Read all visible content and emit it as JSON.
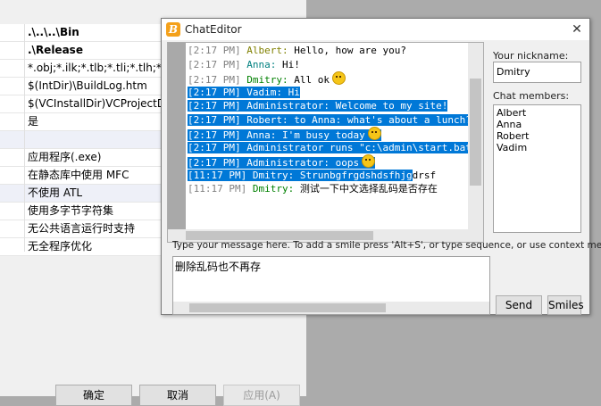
{
  "background": {
    "rows": [
      {
        "text": ".\\..\\..\\Bin",
        "bold": true
      },
      {
        "text": ".\\Release",
        "bold": true
      },
      {
        "text": "*.obj;*.ilk;*.tlb;*.tli;*.tlh;*.tmp",
        "bold": false
      },
      {
        "text": "$(IntDir)\\BuildLog.htm",
        "bold": false
      },
      {
        "text": "$(VCInstallDir)VCProjectDefaults",
        "bold": false
      },
      {
        "text": "是",
        "bold": false
      },
      {
        "text": "",
        "bold": false
      },
      {
        "text": "应用程序(.exe)",
        "bold": false
      },
      {
        "text": "在静态库中使用 MFC",
        "bold": false
      },
      {
        "text": "不使用 ATL",
        "bold": false
      },
      {
        "text": "使用多字节字符集",
        "bold": false
      },
      {
        "text": "无公共语言运行时支持",
        "bold": false
      },
      {
        "text": "无全程序优化",
        "bold": false
      }
    ],
    "buttons": {
      "ok": "确定",
      "cancel": "取消",
      "apply": "应用(A)"
    }
  },
  "window": {
    "icon_glyph": "B",
    "title": "ChatEditor",
    "close_glyph": "✕"
  },
  "chat": {
    "messages": [
      {
        "time": "[2:17 PM]",
        "nick": "Albert:",
        "text": " Hello, how are you?",
        "color": "#808000",
        "selected": false,
        "smile": false
      },
      {
        "time": "[2:17 PM]",
        "nick": "Anna:",
        "text": " Hi!",
        "color": "#008080",
        "selected": false,
        "smile": false
      },
      {
        "time": "[2:17 PM]",
        "nick": "Dmitry:",
        "text": " All ok",
        "color": "#008000",
        "selected": false,
        "smile": true
      },
      {
        "time": "[2:17 PM]",
        "nick": "Vadim:",
        "text": " Hi",
        "color": "#0000ff",
        "selected": true,
        "smile": false
      },
      {
        "time": "[2:17 PM]",
        "nick": "Administrator:",
        "text": " Welcome to my site!",
        "color": "#800000",
        "selected": true,
        "smile": false
      },
      {
        "time": "[2:17 PM]",
        "nick": "Robert:",
        "text": " to Anna: what's about a lunch?",
        "color": "#800080",
        "selected": true,
        "smile": false
      },
      {
        "time": "[2:17 PM]",
        "nick": "Anna:",
        "text": " I'm busy today",
        "color": "#008080",
        "selected": true,
        "smile": true
      },
      {
        "time": "[2:17 PM]",
        "nick": "Administrator",
        "text": " runs \"c:\\admin\\start.bat\" (Fi",
        "color": "#800000",
        "selected": true,
        "smile": false
      },
      {
        "time": "[2:17 PM]",
        "nick": "Administrator:",
        "text": " oops",
        "color": "#800000",
        "selected": true,
        "smile": true
      },
      {
        "time": "[11:17 PM]",
        "nick": "Dmitry:",
        "text": " Strunbgfrgdshdsfhjg",
        "tail": "drsf",
        "color": "#008000",
        "selected": true,
        "smile": false
      },
      {
        "time": "[11:17 PM]",
        "nick": "Dmitry:",
        "text": " 测试一下中文选择乱码是否存在",
        "color": "#008000",
        "selected": false,
        "smile": false
      }
    ]
  },
  "side": {
    "nickname_label": "Your nickname:",
    "nickname_value": "Dmitry",
    "members_label": "Chat members:",
    "members": [
      "Albert",
      "Anna",
      "Robert",
      "Vadim"
    ]
  },
  "input": {
    "hint": "Type your message here. To add a smile press 'Alt+S', or type sequence, or use context menu.",
    "value": "删除乱码也不再存"
  },
  "buttons": {
    "send": "Send",
    "smiles": "Smiles"
  }
}
